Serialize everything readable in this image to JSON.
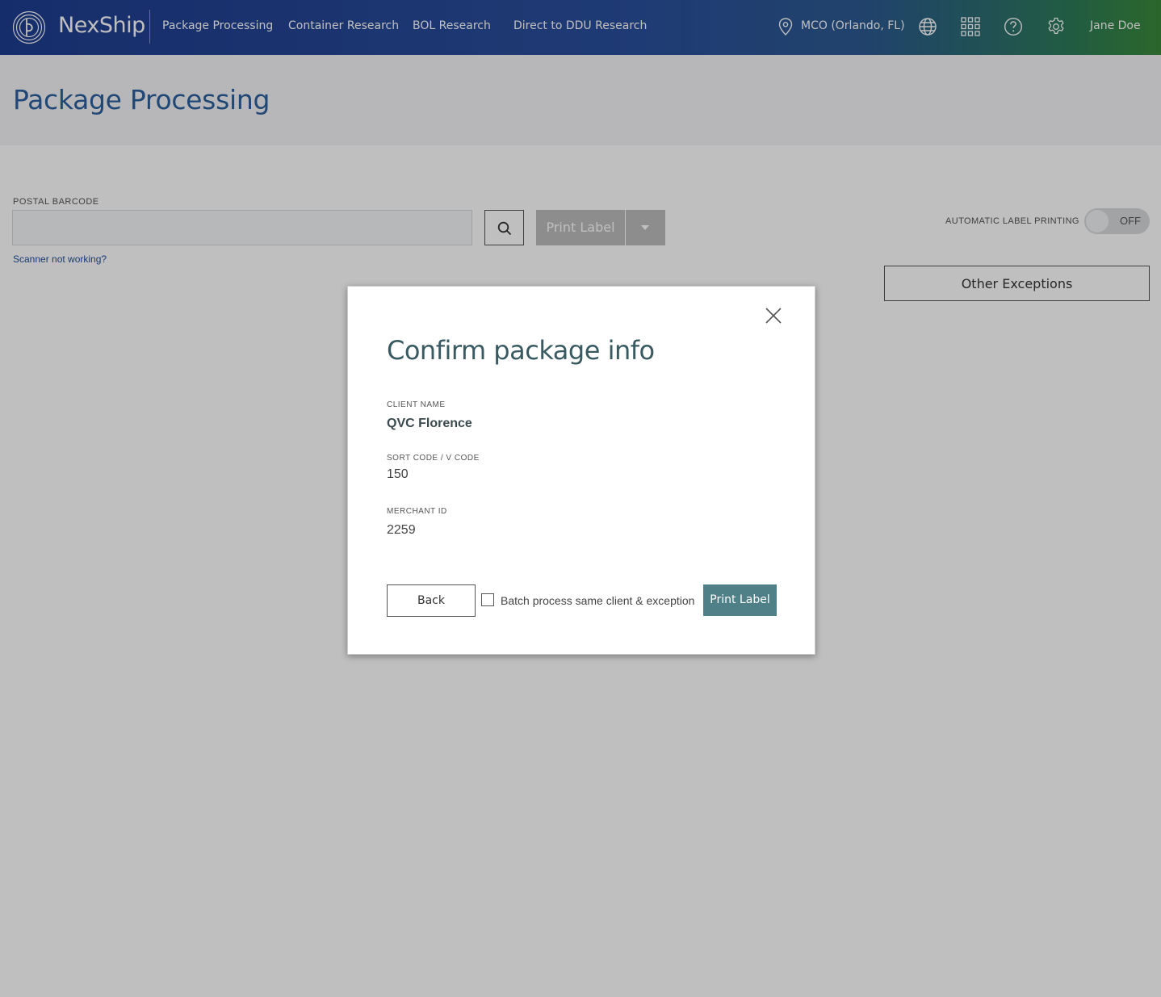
{
  "brand": {
    "name": "NexShip"
  },
  "nav": {
    "links": [
      "Package Processing",
      "Container Research",
      "BOL Research",
      "Direct to DDU Research"
    ],
    "location": "MCO (Orlando, FL)",
    "user": "Jane Doe"
  },
  "page": {
    "title": "Package Processing",
    "postal_barcode_label": "POSTAL BARCODE",
    "postal_barcode_value": "",
    "print_label_button": "Print Label",
    "scanner_link": "Scanner not working?",
    "auto_print_label": "AUTOMATIC LABEL PRINTING",
    "auto_print_state": "OFF",
    "other_exceptions_button": "Other Exceptions"
  },
  "modal": {
    "title": "Confirm package info",
    "client_name_label": "CLIENT NAME",
    "client_name": "QVC Florence",
    "sort_code_label": "SORT CODE / V CODE",
    "sort_code": "150",
    "merchant_id_label": "MERCHANT ID",
    "merchant_id": "2259",
    "back_button": "Back",
    "batch_checkbox_label": "Batch process same client & exception",
    "batch_checked": false,
    "print_button": "Print Label"
  },
  "colors": {
    "title_blue": "#2b5f9e",
    "modal_accent": "#4f7f87",
    "disabled_button": "#bdbdbd"
  }
}
